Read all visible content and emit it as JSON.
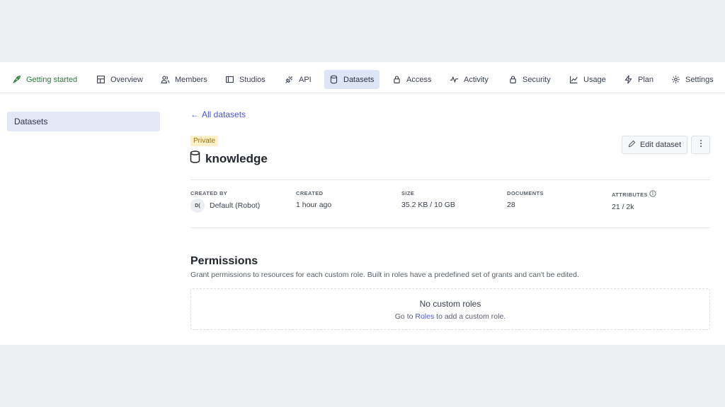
{
  "nav": {
    "tabs": [
      {
        "label": "Getting started",
        "icon": "rocket-icon"
      },
      {
        "label": "Overview",
        "icon": "layout-icon"
      },
      {
        "label": "Members",
        "icon": "users-icon"
      },
      {
        "label": "Studios",
        "icon": "studio-icon"
      },
      {
        "label": "API",
        "icon": "plug-icon"
      },
      {
        "label": "Datasets",
        "icon": "database-icon"
      },
      {
        "label": "Access",
        "icon": "lock-icon"
      },
      {
        "label": "Activity",
        "icon": "activity-icon"
      },
      {
        "label": "Security",
        "icon": "lock-icon"
      },
      {
        "label": "Usage",
        "icon": "chart-icon"
      },
      {
        "label": "Plan",
        "icon": "bolt-icon"
      },
      {
        "label": "Settings",
        "icon": "gear-icon"
      }
    ],
    "active": "Datasets"
  },
  "sidebar": {
    "items": [
      {
        "label": "Datasets"
      }
    ]
  },
  "main": {
    "back_label": "All datasets",
    "badge": "Private",
    "dataset_name": "knowledge",
    "edit_label": "Edit dataset",
    "meta": {
      "created_by_label": "CREATED BY",
      "created_by_avatar": "D(",
      "created_by_value": "Default (Robot)",
      "created_label": "CREATED",
      "created_value": "1 hour ago",
      "size_label": "SIZE",
      "size_value": "35.2 KB / 10 GB",
      "documents_label": "DOCUMENTS",
      "documents_value": "28",
      "attributes_label": "ATTRIBUTES",
      "attributes_value": "21 / 2k"
    },
    "permissions": {
      "title": "Permissions",
      "description": "Grant permissions to resources for each custom role. Built in roles have a predefined set of grants and can't be edited.",
      "empty_title": "No custom roles",
      "empty_prefix": "Go to",
      "empty_link": "Roles",
      "empty_suffix": "to add a custom role."
    }
  },
  "colors": {
    "accent": "#4a55d8",
    "active_tab_bg": "#dde5f7",
    "getting_started": "#2f7a3f",
    "badge_bg": "#fdf1c9"
  }
}
